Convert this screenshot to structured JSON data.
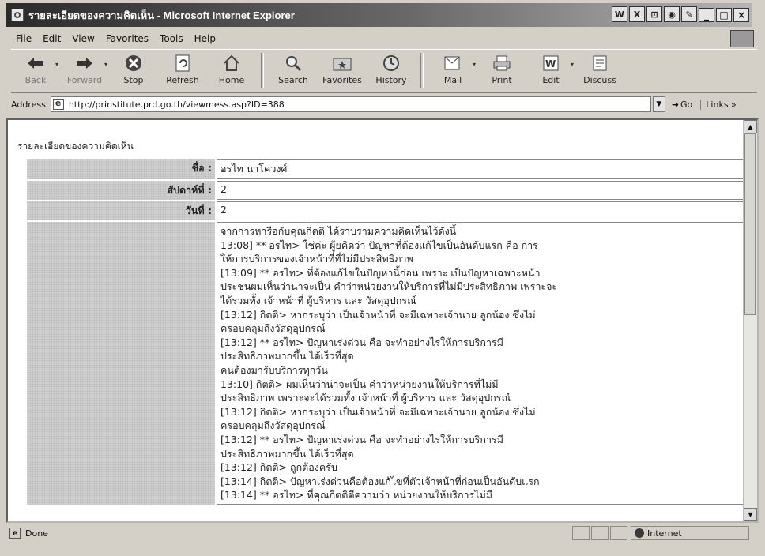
{
  "window": {
    "title": "รายละเอียดของความคิดเห็น - Microsoft Internet Explorer",
    "tray_icons": [
      "W",
      "X",
      "⊡",
      "◉",
      "✎"
    ],
    "controls": {
      "minimize": "_",
      "maximize": "□",
      "close": "×"
    }
  },
  "menu": {
    "file": "File",
    "edit": "Edit",
    "view": "View",
    "favorites": "Favorites",
    "tools": "Tools",
    "help": "Help"
  },
  "toolbar": {
    "back": "Back",
    "forward": "Forward",
    "stop": "Stop",
    "refresh": "Refresh",
    "home": "Home",
    "search": "Search",
    "favorites": "Favorites",
    "history": "History",
    "mail": "Mail",
    "print": "Print",
    "edit": "Edit",
    "discuss": "Discuss"
  },
  "address": {
    "label": "Address",
    "url": "http://prinstitute.prd.go.th/viewmess.asp?ID=388",
    "go": "Go",
    "links": "Links"
  },
  "page": {
    "heading": "รายละเอียดของความคิดเห็น",
    "fields": {
      "name_label": "ชื่อ :",
      "name_value": "อรไท นาโควงศ์",
      "week_label": "สัปดาห์ที่ :",
      "week_value": "2",
      "day_label": "วันที่ :",
      "day_value": "2"
    },
    "message_lines": [
      "จากการหารือกับคุณกิตติ ได้ราบรามความคิดเห็นไว้ดังนี้",
      "13:08] ** อรไท> ใช่ค่ะ ผู้ยคิดว่า ปัญหาที่ต้องแก้ไขเป็นอันดับแรก คือ การ",
      "ให้การบริการของเจ้าหน้าที่ที่ไม่มีประสิทธิภาพ",
      "[13:09] ** อรไท> ที่ต้องแก้ไขในปัญหานี้ก่อน เพราะ เป็นปัญหาเฉพาะหน้า",
      "ประชนผมเห็นว่าน่าจะเป็น คำว่าหน่วยงานให้บริการที่ไม่มีประสิทธิภาพ เพราะจะ",
      "ได้รวมทั้ง เจ้าหน้าที่ ผู้บริหาร และ วัสดุอุปกรณ์",
      "[13:12] กิตติ> หากระบุว่า เป็นเจ้าหน้าที่ จะมีเฉพาะเจ้านาย ลูกน้อง ซึ่งไม่",
      "ครอบคลุมถึงวัสดุอุปกรณ์",
      "[13:12] ** อรไท> ปัญหาเร่งด่วน คือ จะทำอย่างไรให้การบริการมี",
      "ประสิทธิภาพมากขึ้น ได้เร็วที่สุด",
      "คนต้องมารับบริการทุกวัน",
      "13:10] กิตติ> ผมเห็นว่าน่าจะเป็น คำว่าหน่วยงานให้บริการที่ไม่มี",
      "ประสิทธิภาพ เพราะจะได้รวมทั้ง เจ้าหน้าที่ ผู้บริหาร และ วัสดุอุปกรณ์",
      "[13:12] กิตติ> หากระบุว่า เป็นเจ้าหน้าที่ จะมีเฉพาะเจ้านาย ลูกน้อง ซึ่งไม่",
      "ครอบคลุมถึงวัสดุอุปกรณ์",
      "[13:12] ** อรไท> ปัญหาเร่งด่วน คือ จะทำอย่างไรให้การบริการมี",
      "ประสิทธิภาพมากขึ้น ได้เร็วที่สุด",
      "[13:12] กิตติ> ถูกต้องครับ",
      "[13:14] กิตติ> ปัญหาเร่งด่วนคือต้องแก้ไขที่ตัวเจ้าหน้าที่ก่อนเป็นอันดับแรก",
      "[13:14] ** อรไท> ที่คุณกิตติตีความว่า หน่วยงานให้บริการไม่มี"
    ]
  },
  "status": {
    "text": "Done",
    "zone": "Internet"
  }
}
